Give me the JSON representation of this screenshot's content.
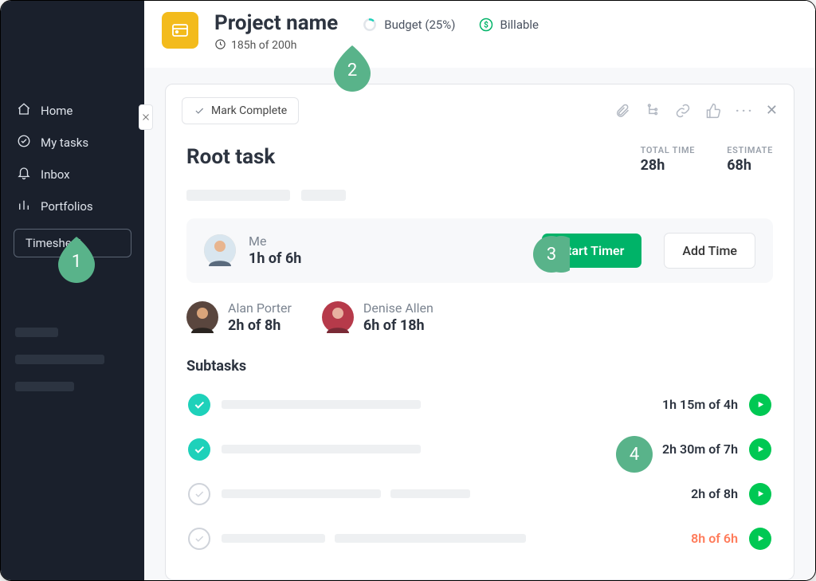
{
  "sidebar": {
    "items": [
      {
        "label": "Home"
      },
      {
        "label": "My tasks"
      },
      {
        "label": "Inbox"
      },
      {
        "label": "Portfolios"
      }
    ],
    "timesheet_label": "Timesheet"
  },
  "project": {
    "name": "Project name",
    "hours": "185h of 200h",
    "budget_label": "Budget (25%)",
    "billable_label": "Billable"
  },
  "task": {
    "mark_complete_label": "Mark Complete",
    "title": "Root task",
    "total_time_label": "TOTAL TIME",
    "total_time": "28h",
    "estimate_label": "ESTIMATE",
    "estimate": "68h",
    "me": {
      "name": "Me",
      "time": "1h of 6h"
    },
    "start_timer_label": "Start Timer",
    "add_time_label": "Add Time",
    "members": [
      {
        "name": "Alan Porter",
        "time": "2h of 8h"
      },
      {
        "name": "Denise Allen",
        "time": "6h of 18h"
      }
    ],
    "subtasks_title": "Subtasks",
    "subtasks": [
      {
        "done": true,
        "time": "1h 15m of 4h",
        "over": false
      },
      {
        "done": true,
        "time": "2h 30m of 7h",
        "over": false
      },
      {
        "done": false,
        "time": "2h of 8h",
        "over": false
      },
      {
        "done": false,
        "time": "8h of 6h",
        "over": true
      }
    ]
  },
  "callouts": {
    "1": "1",
    "2": "2",
    "3": "3",
    "4": "4"
  }
}
